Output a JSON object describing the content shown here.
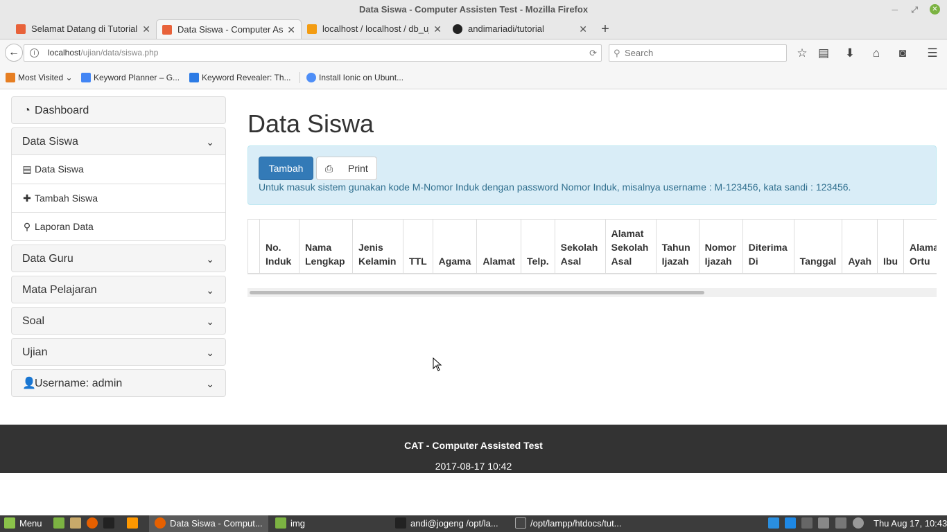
{
  "window": {
    "title": "Data Siswa - Computer Assisten Test - Mozilla Firefox"
  },
  "tabs": [
    {
      "label": "Selamat Datang di Tutorial"
    },
    {
      "label": "Data Siswa - Computer Assisten Test"
    },
    {
      "label": "localhost / localhost / db_ujian"
    },
    {
      "label": "andimariadi/tutorial"
    }
  ],
  "url": {
    "host": "localhost",
    "path": "/ujian/data/siswa.php"
  },
  "search": {
    "placeholder": "Search"
  },
  "bookmarks": [
    {
      "label": "Most Visited"
    },
    {
      "label": "Keyword Planner – G..."
    },
    {
      "label": "Keyword Revealer: Th..."
    },
    {
      "label": "Install Ionic on Ubunt..."
    }
  ],
  "sidebar": {
    "dashboard": "Dashboard",
    "data_siswa": "Data Siswa",
    "sub": [
      "Data Siswa",
      "Tambah Siswa",
      "Laporan Data"
    ],
    "data_guru": "Data Guru",
    "mata_pelajaran": "Mata Pelajaran",
    "soal": "Soal",
    "ujian": "Ujian",
    "username": "Username: admin"
  },
  "main": {
    "title": "Data Siswa",
    "btn_tambah": "Tambah",
    "btn_print": "Print",
    "info": "Untuk masuk sistem gunakan kode M-Nomor Induk dengan password Nomor Induk, misalnya username : M-123456, kata sandi : 123456."
  },
  "table": {
    "headers": [
      "",
      "No. Induk",
      "Nama Lengkap",
      "Jenis Kelamin",
      "TTL",
      "Agama",
      "Alamat",
      "Telp.",
      "Sekolah Asal",
      "Alamat Sekolah Asal",
      "Tahun Ijazah",
      "Nomor Ijazah",
      "Diterima Di",
      "Tanggal",
      "Ayah",
      "Ibu",
      "Alamat Ortu"
    ]
  },
  "footer": {
    "title": "CAT - Computer Assisted Test",
    "datetime": "2017-08-17 10:42"
  },
  "taskbar": {
    "menu": "Menu",
    "apps": [
      "Data Siswa - Comput...",
      "img",
      "andi@jogeng /opt/la...",
      "/opt/lampp/htdocs/tut..."
    ],
    "clock": "Thu Aug 17, 10:43"
  },
  "colors": {
    "primary": "#337ab7",
    "info_bg": "#d9edf7",
    "info_text": "#31708f",
    "footer_bg": "#333333"
  }
}
